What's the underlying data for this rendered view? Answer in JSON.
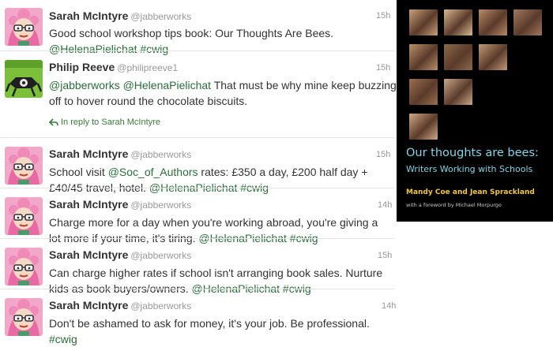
{
  "tweets": [
    {
      "name": "Sarah McIntyre",
      "handle": "@jabberworks",
      "time": "15h",
      "avatar": "sarah-avatar",
      "lines": [
        [
          {
            "t": "Good school workshop tips book: Our Thoughts Are Bees."
          }
        ],
        [
          {
            "t": "@HelenaPielichat",
            "link": true
          },
          {
            "t": " "
          },
          {
            "t": "#cwig",
            "link": true
          }
        ]
      ]
    },
    {
      "name": "Philip Reeve",
      "handle": "@philipreeve1",
      "time": "15h",
      "avatar": "philip-avatar",
      "lines": [
        [
          {
            "t": "@jabberworks",
            "link": true
          },
          {
            "t": " "
          },
          {
            "t": "@HelenaPielichat",
            "link": true
          },
          {
            "t": " That must be why mine keep buzzing"
          }
        ],
        [
          {
            "t": "off to hover round the chocolate biscuits."
          }
        ]
      ],
      "reply": "In reply to Sarah McIntyre"
    },
    {
      "name": "Sarah McIntyre",
      "handle": "@jabberworks",
      "time": "15h",
      "avatar": "sarah-avatar",
      "lines": [
        [
          {
            "t": "School visit "
          },
          {
            "t": "@Soc_of_Authors",
            "link": true
          },
          {
            "t": " rates: £350 a day, £200 half day +"
          }
        ],
        [
          {
            "t": "£40/45 travel, hotel. "
          },
          {
            "t": "@HelenaPielichat",
            "link": true
          },
          {
            "t": " "
          },
          {
            "t": "#cwig",
            "link": true
          }
        ]
      ]
    },
    {
      "name": "Sarah McIntyre",
      "handle": "@jabberworks",
      "time": "14h",
      "avatar": "sarah-avatar",
      "lines": [
        [
          {
            "t": "Charge more for a day when you're working abroad, you're giving a"
          }
        ],
        [
          {
            "t": "lot more if your time, it's tiring. "
          },
          {
            "t": "@HelenaPielichat",
            "link": true
          },
          {
            "t": " "
          },
          {
            "t": "#cwig",
            "link": true
          }
        ]
      ]
    },
    {
      "name": "Sarah McIntyre",
      "handle": "@jabberworks",
      "time": "15h",
      "avatar": "sarah-avatar",
      "lines": [
        [
          {
            "t": "Can charge higher rates if school isn't arranging book sales. Nurture"
          }
        ],
        [
          {
            "t": "kids as book buyers/owners. "
          },
          {
            "t": "@HelenaPielichat",
            "link": true
          },
          {
            "t": " "
          },
          {
            "t": "#cwig",
            "link": true
          }
        ]
      ]
    },
    {
      "name": "Sarah McIntyre",
      "handle": "@jabberworks",
      "time": "14h",
      "avatar": "sarah-avatar",
      "lines": [
        [
          {
            "t": "Don't be ashamed to ask for money, it's your job. Be professional."
          }
        ],
        [
          {
            "t": "#cwig",
            "link": true
          }
        ]
      ]
    }
  ],
  "book": {
    "title": "Our thoughts are bees:",
    "subtitle": "Writers Working with Schools",
    "authors": "Mandy Coe and Jean Sprackland",
    "foreword": "with a foreword by Michael Morpurgo"
  },
  "colors": {
    "link": "#2a6e3a",
    "book_title": "#7fd6e8",
    "book_authors": "#f2c83a"
  }
}
